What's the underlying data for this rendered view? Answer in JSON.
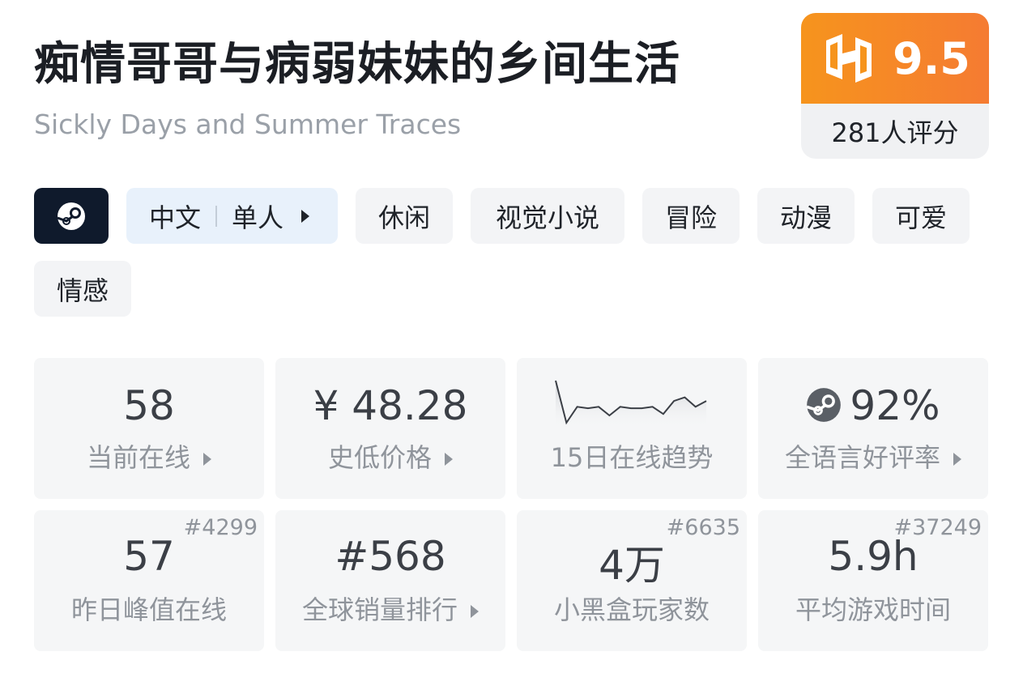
{
  "header": {
    "title": "痴情哥哥与病弱妹妹的乡间生活",
    "subtitle": "Sickly Days and Summer Traces"
  },
  "score": {
    "logo_icon": "heybox-logo-icon",
    "value": "9.5",
    "count": "281人评分",
    "accent": "#f6941d"
  },
  "tags": {
    "platform_icon": "steam-icon",
    "language": "中文",
    "mode": "单人",
    "items": [
      "休闲",
      "视觉小说",
      "冒险",
      "动漫",
      "可爱",
      "情感"
    ]
  },
  "stats": {
    "current_online": {
      "value": "58",
      "label": "当前在线"
    },
    "lowest_price": {
      "value": "¥ 48.28",
      "label": "史低价格"
    },
    "trend": {
      "label": "15日在线趋势",
      "values": [
        78,
        20,
        42,
        40,
        42,
        30,
        42,
        40,
        40,
        42,
        32,
        50,
        55,
        42,
        50
      ]
    },
    "review_rate": {
      "value": "92%",
      "label": "全语言好评率",
      "icon": "steam-icon"
    },
    "peak_yesterday": {
      "value": "57",
      "label": "昨日峰值在线",
      "rank": "#4299"
    },
    "global_sales": {
      "value": "#568",
      "label": "全球销量排行"
    },
    "heybox_players": {
      "value": "4万",
      "label": "小黑盒玩家数",
      "rank": "#6635"
    },
    "avg_playtime": {
      "value": "5.9h",
      "label": "平均游戏时间",
      "rank": "#37249"
    }
  }
}
